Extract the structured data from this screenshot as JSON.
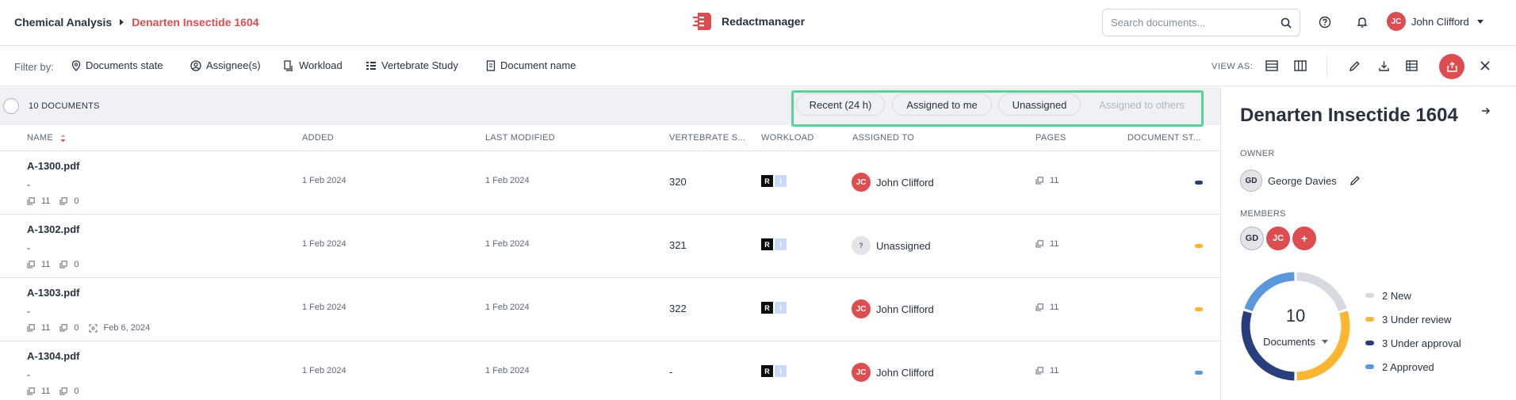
{
  "breadcrumb": {
    "parent": "Chemical Analysis",
    "current": "Denarten Insectide 1604"
  },
  "brand": {
    "name": "Redactmanager",
    "color": "#dd4d50"
  },
  "search": {
    "placeholder": "Search documents...",
    "value": ""
  },
  "user": {
    "initials": "JC",
    "name": "John Clifford"
  },
  "filters": {
    "label": "Filter by:",
    "items": [
      "Documents state",
      "Assignee(s)",
      "Workload",
      "Vertebrate Study",
      "Document name"
    ]
  },
  "view": {
    "label": "VIEW AS:"
  },
  "list": {
    "count_label": "10 DOCUMENTS",
    "quick_filters": [
      "Recent (24 h)",
      "Assigned to me",
      "Unassigned",
      "Assigned to others"
    ],
    "columns": [
      "NAME",
      "ADDED",
      "LAST MODIFIED",
      "VERTEBRATE S...",
      "WORKLOAD",
      "ASSIGNED TO",
      "PAGES",
      "DOCUMENT ST..."
    ],
    "rows": [
      {
        "name": "A-1300.pdf",
        "desc": "-",
        "pages_meta": "11",
        "annot_meta": "0",
        "extra_meta": "",
        "added": "1 Feb 2024",
        "modified": "1 Feb 2024",
        "vertebrate": "320",
        "assignee_initials": "JC",
        "assignee": "John Clifford",
        "pages": "11",
        "status_color": "#283f7c"
      },
      {
        "name": "A-1302.pdf",
        "desc": "-",
        "pages_meta": "11",
        "annot_meta": "0",
        "extra_meta": "",
        "added": "1 Feb 2024",
        "modified": "1 Feb 2024",
        "vertebrate": "321",
        "assignee_initials": "?",
        "assignee": "Unassigned",
        "pages": "11",
        "status_color": "#fcb632"
      },
      {
        "name": "A-1303.pdf",
        "desc": "-",
        "pages_meta": "11",
        "annot_meta": "0",
        "extra_meta": "Feb 6, 2024",
        "added": "1 Feb 2024",
        "modified": "1 Feb 2024",
        "vertebrate": "322",
        "assignee_initials": "JC",
        "assignee": "John Clifford",
        "pages": "11",
        "status_color": "#fcb632"
      },
      {
        "name": "A-1304.pdf",
        "desc": "-",
        "pages_meta": "11",
        "annot_meta": "0",
        "extra_meta": "",
        "added": "1 Feb 2024",
        "modified": "1 Feb 2024",
        "vertebrate": "-",
        "assignee_initials": "JC",
        "assignee": "John Clifford",
        "pages": "11",
        "status_color": "#5b97db"
      }
    ],
    "workload_badges": [
      "R",
      "I"
    ]
  },
  "panel": {
    "title": "Denarten Insectide 1604",
    "owner_label": "OWNER",
    "owner_initials": "GD",
    "owner_name": "George Davies",
    "members_label": "MEMBERS",
    "members": [
      "GD",
      "JC"
    ],
    "add_member": "+",
    "total": "10",
    "total_label": "Documents",
    "legend": [
      {
        "label": "2 New",
        "value": 2,
        "color": "#d6d9df"
      },
      {
        "label": "3 Under review",
        "value": 3,
        "color": "#fcb632"
      },
      {
        "label": "3 Under approval",
        "value": 3,
        "color": "#283f7c"
      },
      {
        "label": "2 Approved",
        "value": 2,
        "color": "#5b97db"
      }
    ]
  }
}
